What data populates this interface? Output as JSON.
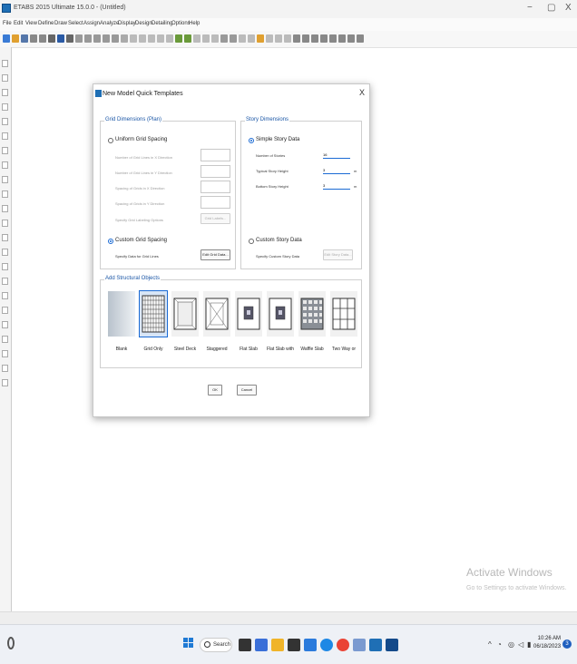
{
  "window": {
    "title": "ETABS 2015 Ultimate 15.0.0 - (Untitled)",
    "minimize": "−",
    "restore": "▢",
    "close": "X"
  },
  "menu": [
    "File",
    "Edit",
    "View",
    "Define",
    "Draw",
    "Select",
    "Assign",
    "Analyze",
    "Display",
    "Design",
    "Detailing",
    "Options",
    "Help"
  ],
  "dialog": {
    "title": "New Model Quick Templates",
    "close": "X",
    "grid_group": {
      "title": "Grid Dimensions (Plan)",
      "uniform_label": "Uniform Grid Spacing",
      "fields": [
        "Number of Grid Lines in X Direction",
        "Number of Grid Lines in Y Direction",
        "Spacing of Grids in X Direction",
        "Spacing of Grids in Y Direction"
      ],
      "labeling_label": "Specify Grid Labeling Options",
      "grid_labels_button": "Grid Labels...",
      "custom_label": "Custom Grid Spacing",
      "custom_data_label": "Specify Data for Grid Lines",
      "edit_grid_button": "Edit Grid Data..."
    },
    "story_group": {
      "title": "Story Dimensions",
      "simple_label": "Simple Story Data",
      "number_label": "Number of Stories",
      "number_value": "16",
      "typical_label": "Typical Story Height",
      "typical_value": "3",
      "typical_unit": "m",
      "bottom_label": "Bottom Story Height",
      "bottom_value": "3",
      "bottom_unit": "m",
      "custom_label": "Custom Story Data",
      "custom_data_label": "Specify Custom Story Data",
      "edit_story_button": "Edit Story Data..."
    },
    "structural_group": {
      "title": "Add Structural Objects",
      "tiles": [
        "Blank",
        "Grid Only",
        "Steel Deck",
        "Staggered",
        "Flat Slab",
        "Flat Slab with",
        "Waffle Slab",
        "Two Way or"
      ]
    },
    "ok_button": "OK",
    "cancel_button": "Cancel"
  },
  "watermark": {
    "line1": "Activate Windows",
    "line2": "Go to Settings to activate Windows."
  },
  "taskbar": {
    "search_label": "Search",
    "time": "10:26 AM",
    "date": "06/18/2023",
    "notification_count": "3"
  }
}
